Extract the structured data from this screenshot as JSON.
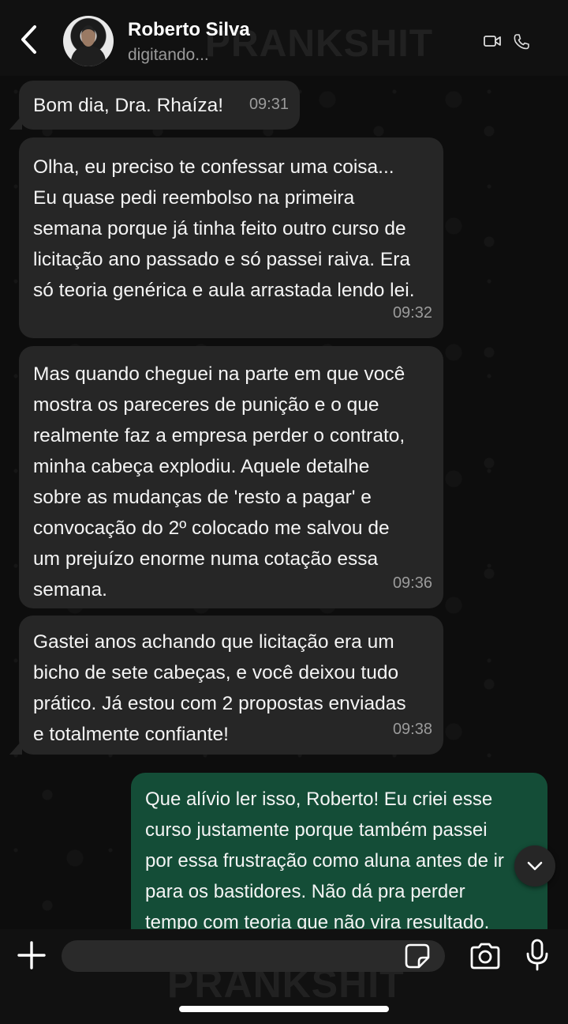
{
  "header": {
    "contact_name": "Roberto Silva",
    "status": "digitando..."
  },
  "watermark_text": "PRANKSHIT",
  "messages": [
    {
      "direction": "in",
      "text": "Bom dia, Dra. Rhaíza!",
      "time": "09:31"
    },
    {
      "direction": "in",
      "text": "Olha, eu preciso te confessar uma coisa...\nEu quase pedi reembolso na primeira\nsemana porque já tinha feito outro curso de\nlicitação ano passado e só passei raiva. Era\nsó teoria genérica e aula arrastada lendo lei.",
      "time": "09:32"
    },
    {
      "direction": "in",
      "text": "Mas quando cheguei na parte em que você\nmostra os pareceres de punição e o que\nrealmente faz a empresa perder o contrato,\nminha cabeça explodiu. Aquele detalhe\nsobre as mudanças de 'resto a pagar' e\nconvocação do 2º colocado me salvou de\num prejuízo enorme numa cotação essa\nsemana.",
      "time": "09:36"
    },
    {
      "direction": "in",
      "text": "Gastei anos achando que licitação era um\nbicho de sete cabeças, e você deixou tudo\nprático. Já estou com 2 propostas enviadas\ne totalmente confiante!",
      "time": "09:38"
    },
    {
      "direction": "out",
      "text": "Que alívio ler isso, Roberto! Eu criei esse\ncurso justamente porque também passei\npor essa frustração como aluna antes de ir\npara os bastidores. Não dá pra perder\ntempo com teoria que não vira resultado.",
      "time": ""
    }
  ],
  "composer": {
    "placeholder": ""
  },
  "colors": {
    "incoming_bubble": "#262626",
    "outgoing_bubble": "#144d37",
    "header_bg": "#111111",
    "timestamp": "#9b9b9b"
  },
  "icons": {
    "back": "chevron-left-icon",
    "video": "video-camera-icon",
    "call": "phone-icon",
    "scroll": "chevron-down-icon",
    "plus": "plus-icon",
    "sticker": "sticker-icon",
    "camera": "camera-icon",
    "mic": "microphone-icon"
  }
}
